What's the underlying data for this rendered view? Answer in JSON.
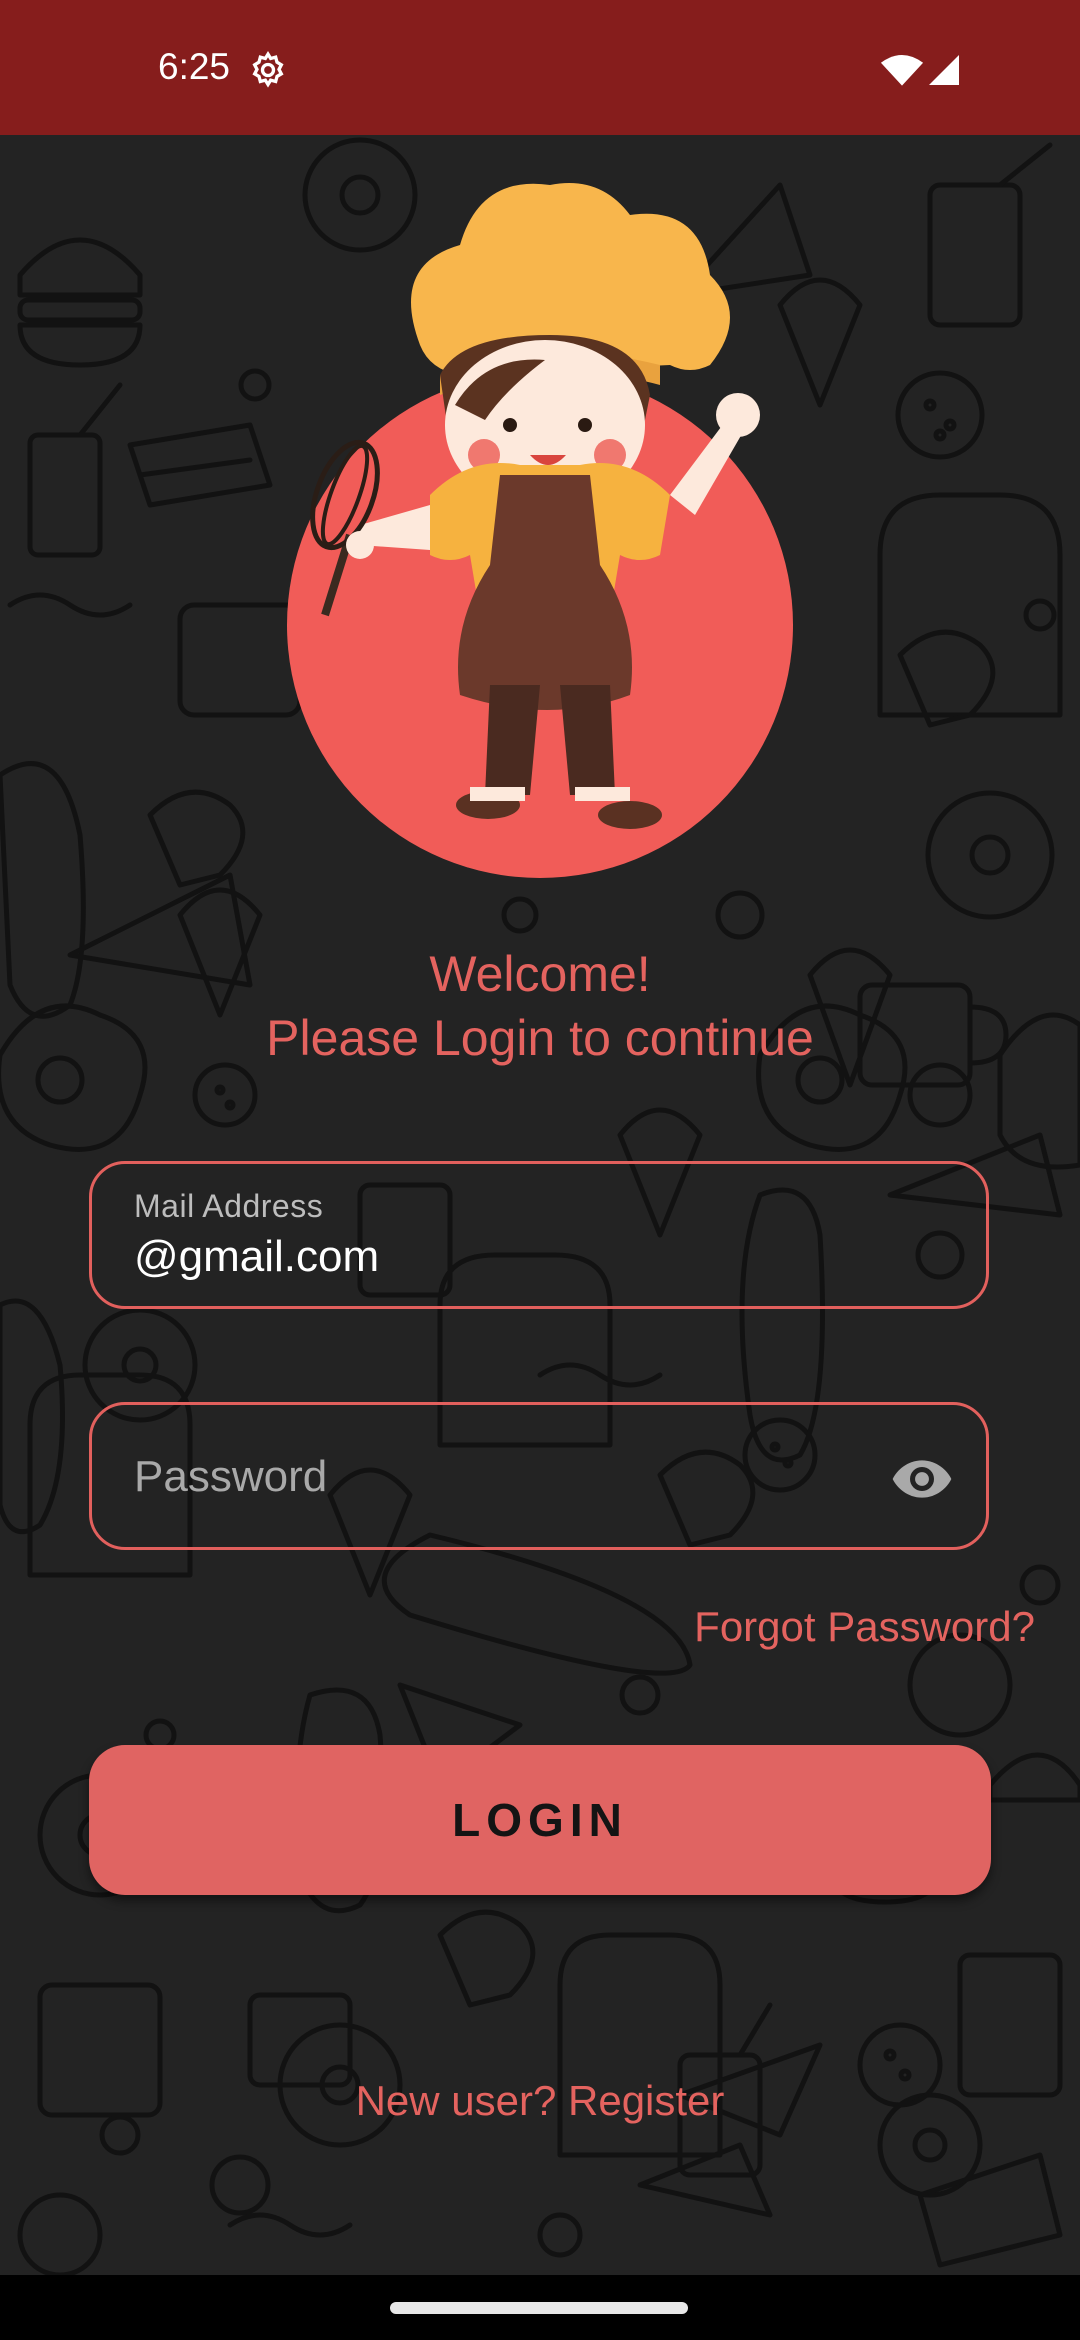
{
  "status_bar": {
    "time": "6:25",
    "settings_icon": "gear-icon",
    "wifi_icon": "wifi-icon",
    "signal_icon": "cell-signal-icon",
    "background_color": "#861d1c"
  },
  "illustration": {
    "icon": "chef-with-whisk-illustration"
  },
  "welcome": {
    "line1": "Welcome!",
    "line2": "Please Login to continue"
  },
  "email_field": {
    "label": "Mail Address",
    "value": "@gmail.com"
  },
  "password_field": {
    "placeholder": "Password",
    "visibility_icon": "eye-icon"
  },
  "forgot_password": "Forgot Password?",
  "login_button": {
    "label": "LOGIN"
  },
  "register_link": "New user? Register",
  "colors": {
    "accent": "#e4635f",
    "button": "#e06462",
    "background": "#232323",
    "status_bar": "#861d1c"
  }
}
